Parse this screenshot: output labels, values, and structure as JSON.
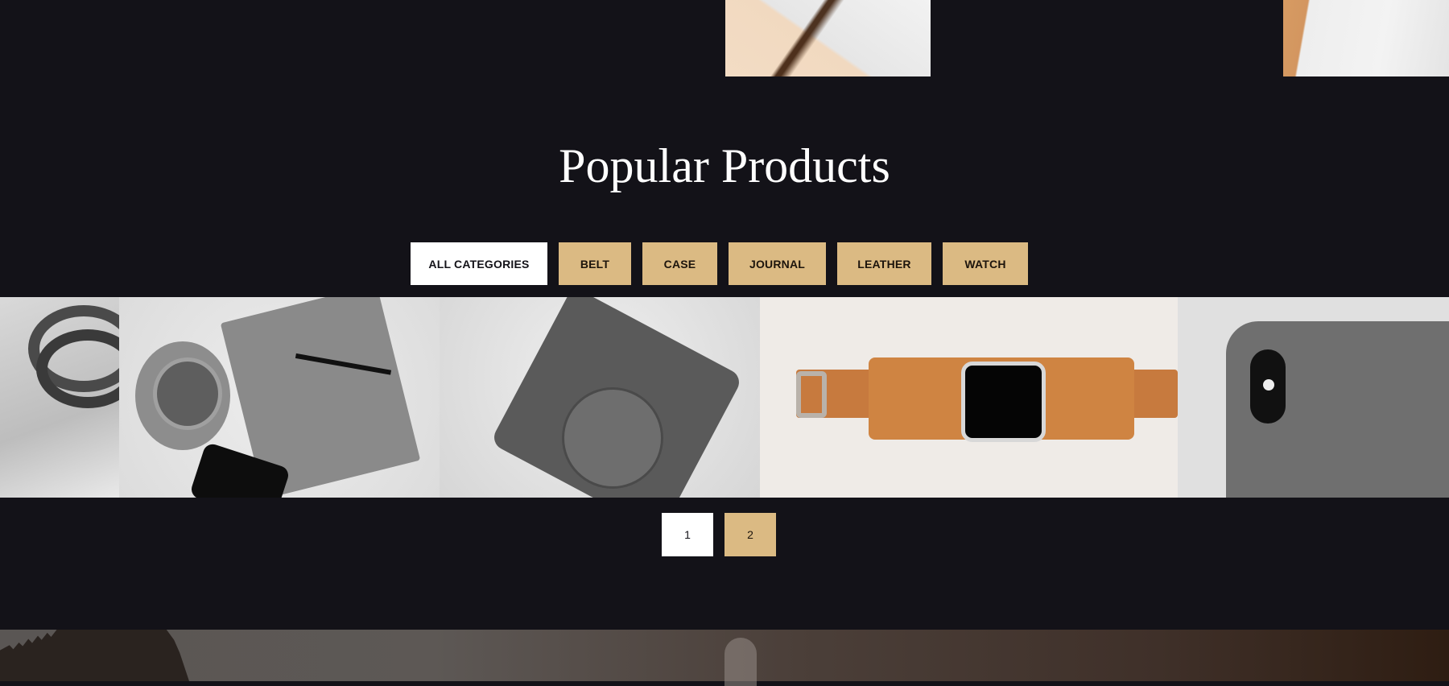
{
  "colors": {
    "background": "#131218",
    "accent": "#dbba83",
    "active": "#ffffff"
  },
  "section": {
    "title": "Popular Products"
  },
  "filters": [
    {
      "label": "ALL CATEGORIES",
      "active": true
    },
    {
      "label": "BELT",
      "active": false
    },
    {
      "label": "CASE",
      "active": false
    },
    {
      "label": "JOURNAL",
      "active": false
    },
    {
      "label": "LEATHER",
      "active": false
    },
    {
      "label": "WATCH",
      "active": false
    }
  ],
  "products": [
    {
      "image": "leather-cord-photo"
    },
    {
      "image": "journal-coffee-glasses-photo"
    },
    {
      "image": "camera-case-photo"
    },
    {
      "image": "leather-watch-strap-photo"
    },
    {
      "image": "phone-case-photo"
    }
  ],
  "pagination": {
    "pages": [
      "1",
      "2"
    ],
    "current": "1"
  }
}
